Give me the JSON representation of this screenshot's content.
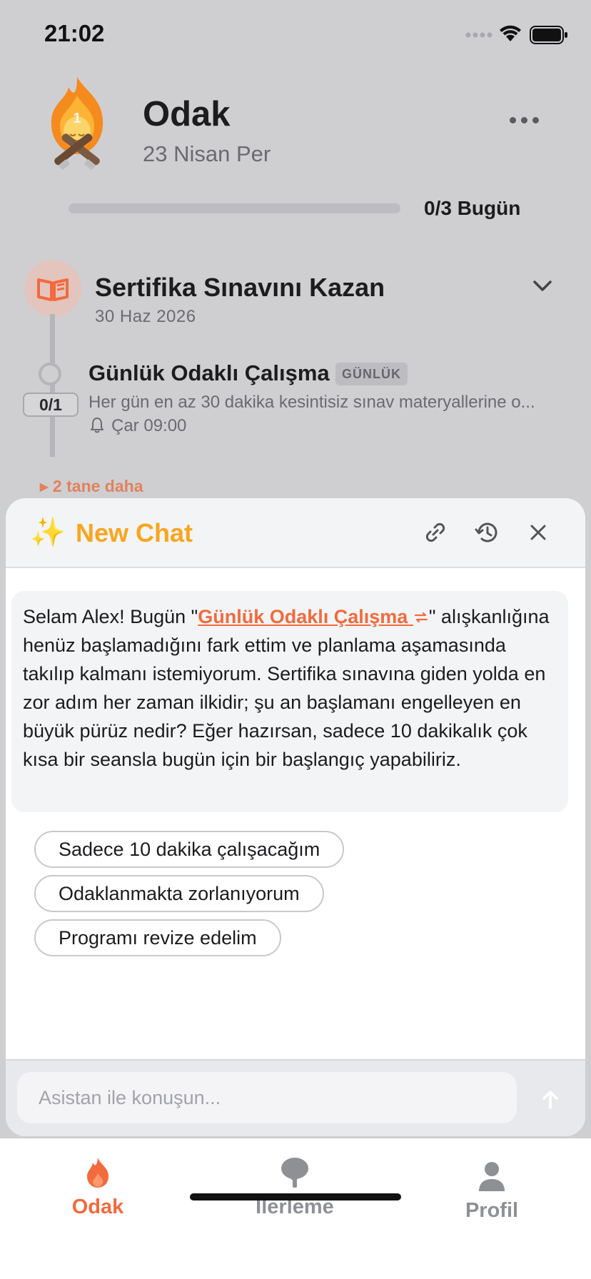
{
  "status": {
    "time": "21:02"
  },
  "header": {
    "title": "Odak",
    "date": "23 Nisan Per",
    "streak_number": "1",
    "progress": {
      "done": 0,
      "total": 3,
      "label": "0/3 Bugün"
    }
  },
  "goal": {
    "title": "Sertifika Sınavını Kazan",
    "date": "30 Haz 2026",
    "habit": {
      "title": "Günlük Odaklı Çalışma",
      "badge": "GÜNLÜK",
      "count": "0/1",
      "description": "Her gün en az 30 dakika kesintisiz sınav materyallerine o...",
      "reminder": "Çar 09:00"
    },
    "more_label": "▸ 2 tane daha"
  },
  "chat": {
    "title": "New Chat",
    "message": {
      "before": "Selam Alex! Bugün \"",
      "habit_link": "Günlük Odaklı Çalışma",
      "after": "\" alışkanlığına henüz başlamadığını fark ettim ve planlama aşamasında takılıp kalmanı istemiyorum. Sertifika sınavına giden yolda en zor adım her zaman ilkidir; şu an başlamanı engelleyen en büyük pürüz nedir? Eğer hazırsan, sadece 10 dakikalık çok kısa bir seansla bugün için bir başlangıç yapabiliriz."
    },
    "suggestions": [
      "Sadece 10 dakika çalışacağım",
      "Odaklanmakta zorlanıyorum",
      "Programı revize edelim"
    ],
    "input_placeholder": "Asistan ile konuşun..."
  },
  "tabs": [
    {
      "label": "Odak",
      "icon": "flame-icon",
      "active": true
    },
    {
      "label": "İlerleme",
      "icon": "tree-icon",
      "active": false
    },
    {
      "label": "Profil",
      "icon": "person-icon",
      "active": false
    }
  ],
  "colors": {
    "accent": "#f26a3d",
    "chat_title": "#f9a51f",
    "background": "#cfcfd2"
  }
}
